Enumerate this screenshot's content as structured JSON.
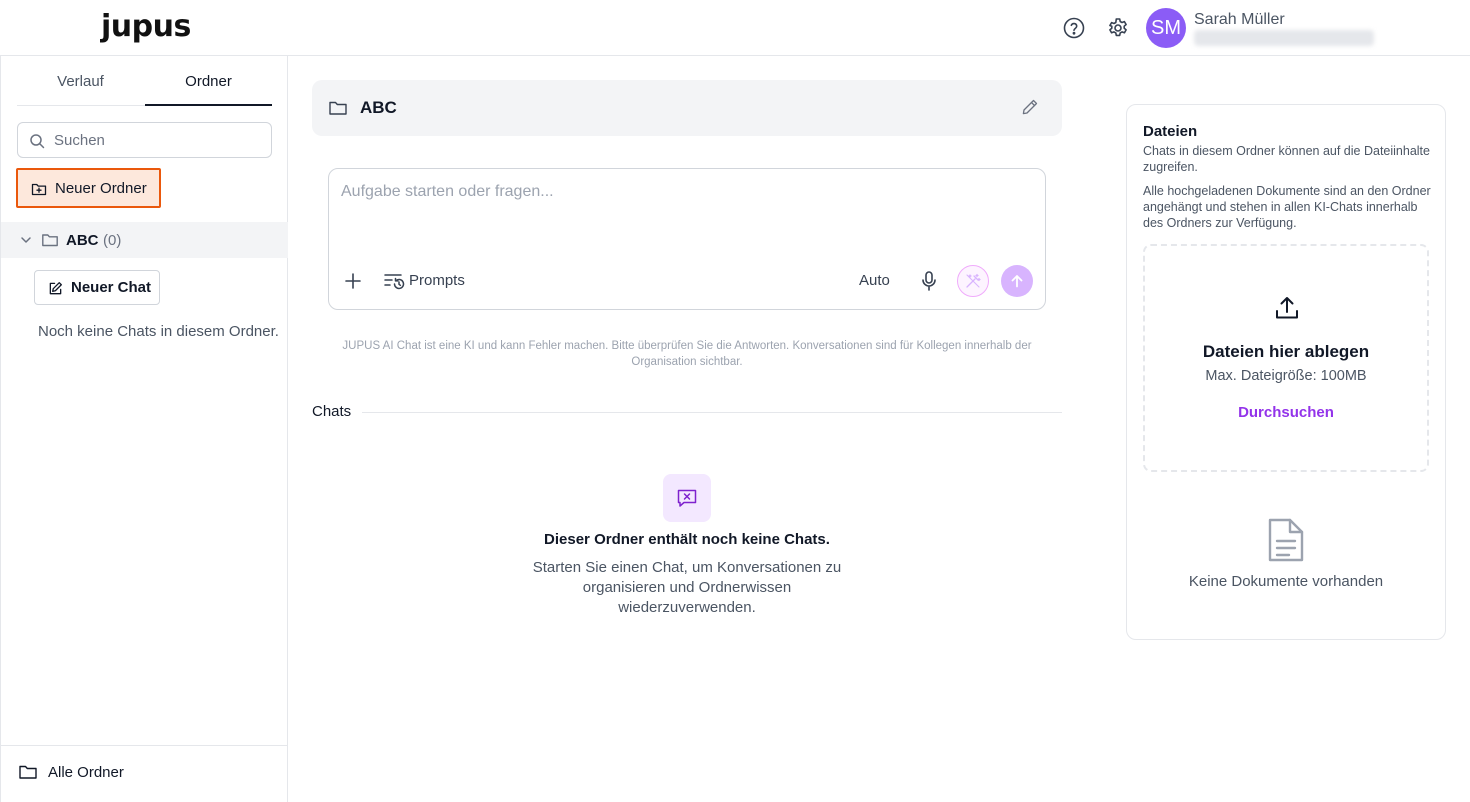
{
  "header": {
    "logo": "jupus",
    "user_initials": "SM",
    "user_name": "Sarah Müller",
    "icons": [
      "help-icon",
      "gear-icon"
    ]
  },
  "sidebar": {
    "tabs": [
      {
        "label": "Verlauf",
        "active": false
      },
      {
        "label": "Ordner",
        "active": true
      }
    ],
    "search_placeholder": "Suchen",
    "new_folder_label": "Neuer Ordner",
    "folder": {
      "name": "ABC",
      "count": "(0)"
    },
    "new_chat_label": "Neuer Chat",
    "no_chats_text": "Noch keine Chats in diesem Ordner.",
    "all_folders_label": "Alle Ordner"
  },
  "main": {
    "folder_title": "ABC",
    "composer_placeholder": "Aufgabe starten oder fragen...",
    "prompts_label": "Prompts",
    "model_label": "Auto",
    "disclaimer": "JUPUS AI Chat ist eine KI und kann Fehler machen. Bitte überprüfen Sie die Antworten. Konversationen sind für Kollegen innerhalb der Organisation sichtbar.",
    "chats_heading": "Chats",
    "empty_title": "Dieser Ordner enthält noch keine Chats.",
    "empty_desc": "Starten Sie einen Chat, um Konversationen zu organisieren und Ordnerwissen wiederzuverwenden."
  },
  "files": {
    "title": "Dateien",
    "desc1": "Chats in diesem Ordner können auf die Dateiinhalte zugreifen.",
    "desc2": "Alle hochgeladenen Dokumente sind an den Ordner angehängt und stehen in allen KI-Chats innerhalb des Ordners zur Verfügung.",
    "dropzone_title": "Dateien hier ablegen",
    "dropzone_sub": "Max. Dateigröße: 100MB",
    "browse_label": "Durchsuchen",
    "no_docs": "Keine Dokumente vorhanden"
  },
  "colors": {
    "accent": "#9333ea",
    "avatar": "#8b5cf6",
    "highlight_border": "#ea580c",
    "highlight_bg": "#fde8dc"
  }
}
